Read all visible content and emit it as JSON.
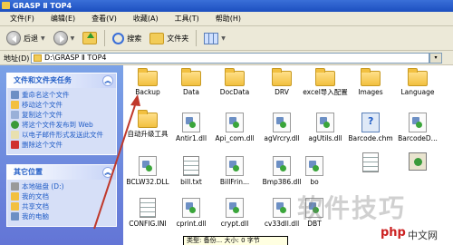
{
  "window": {
    "title": "GRASP Ⅱ TOP4"
  },
  "menu": [
    "文件(F)",
    "编辑(E)",
    "查看(V)",
    "收藏(A)",
    "工具(T)",
    "帮助(H)"
  ],
  "toolbar": {
    "back_label": "后退",
    "search_label": "搜索",
    "folders_label": "文件夹"
  },
  "address": {
    "label": "地址(D)",
    "path": "D:\\GRASP Ⅱ TOP4",
    "go_label": "▾"
  },
  "sidebar": {
    "file_tasks": {
      "title": "文件和文件夹任务",
      "items": [
        "重命名这个文件",
        "移动这个文件",
        "复制这个文件",
        "将这个文件发布到 Web",
        "以电子邮件形式发送此文件",
        "删除这个文件"
      ]
    },
    "other_places": {
      "title": "其它位置",
      "items": [
        "本地磁盘 (D:)",
        "我的文档",
        "共享文档",
        "我的电脑"
      ]
    }
  },
  "files": [
    {
      "name": "Backup",
      "type": "folder"
    },
    {
      "name": "Data",
      "type": "folder"
    },
    {
      "name": "DocData",
      "type": "folder"
    },
    {
      "name": "DRV",
      "type": "folder"
    },
    {
      "name": "excel导入配置",
      "type": "folder"
    },
    {
      "name": "Images",
      "type": "folder"
    },
    {
      "name": "Language",
      "type": "folder"
    },
    {
      "name": "自动升级工具",
      "type": "folder"
    },
    {
      "name": "Antir1.dll",
      "type": "dll"
    },
    {
      "name": "Api_com.dll",
      "type": "dll"
    },
    {
      "name": "agVrcry.dll",
      "type": "dll"
    },
    {
      "name": "agUtils.dll",
      "type": "dll"
    },
    {
      "name": "Barcode.chm",
      "type": "chm"
    },
    {
      "name": "BarcodeD...",
      "type": "dll"
    },
    {
      "name": "BCLW32.DLL",
      "type": "dll"
    },
    {
      "name": "bill.txt",
      "type": "doc"
    },
    {
      "name": "BillFrin...",
      "type": "dll"
    },
    {
      "name": "Bmp386.dll",
      "type": "dll"
    },
    {
      "name": "bo",
      "type": "dll"
    },
    {
      "name": "",
      "type": "doc"
    },
    {
      "name": "",
      "type": "exe"
    },
    {
      "name": "CONFIG.INI",
      "type": "doc"
    },
    {
      "name": "cprint.dll",
      "type": "dll"
    },
    {
      "name": "crypt.dll",
      "type": "dll"
    },
    {
      "name": "cv33dll.dll",
      "type": "dll"
    },
    {
      "name": "DBT",
      "type": "dll"
    }
  ],
  "tooltip": "类型: 备份... 大小: 0 字节",
  "watermark": {
    "main": "软件技巧",
    "brand": "php",
    "brand_cn": "中文网"
  },
  "colors": {
    "title_bar": "#2457c5",
    "sidebar_bg": "#6f8fde",
    "arrow": "#c0392b"
  }
}
